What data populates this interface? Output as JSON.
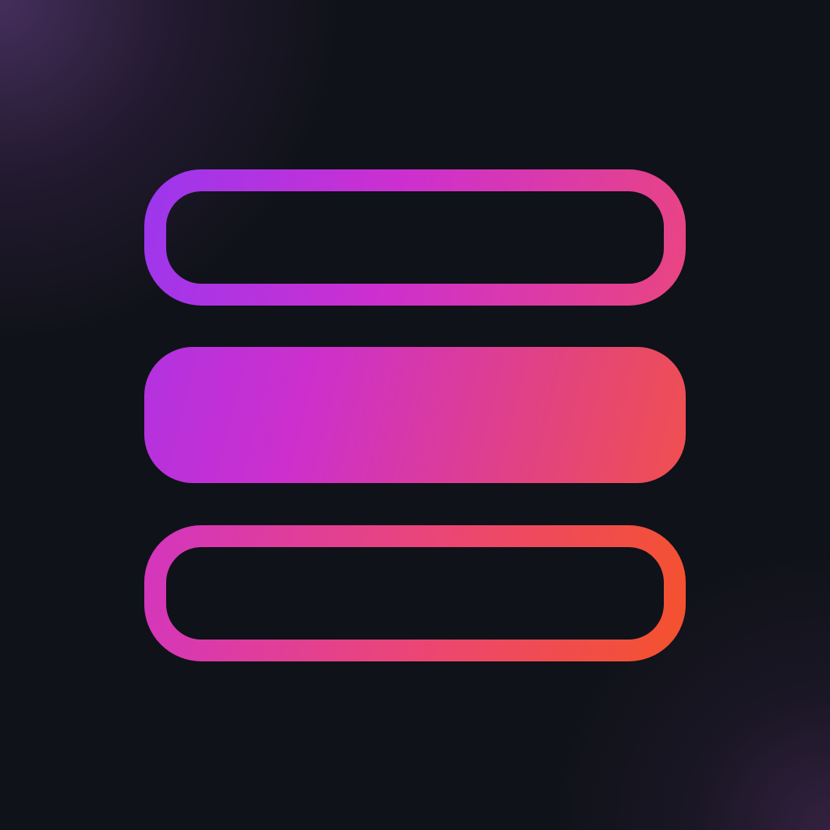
{
  "icon": {
    "name": "stacked-layers-icon",
    "colors": {
      "background": "#0f1218",
      "glow": "#5c3a78",
      "gradient_start": "#9b37ee",
      "gradient_mid": "#cc2fd0",
      "gradient_end": "#f5522c"
    }
  }
}
